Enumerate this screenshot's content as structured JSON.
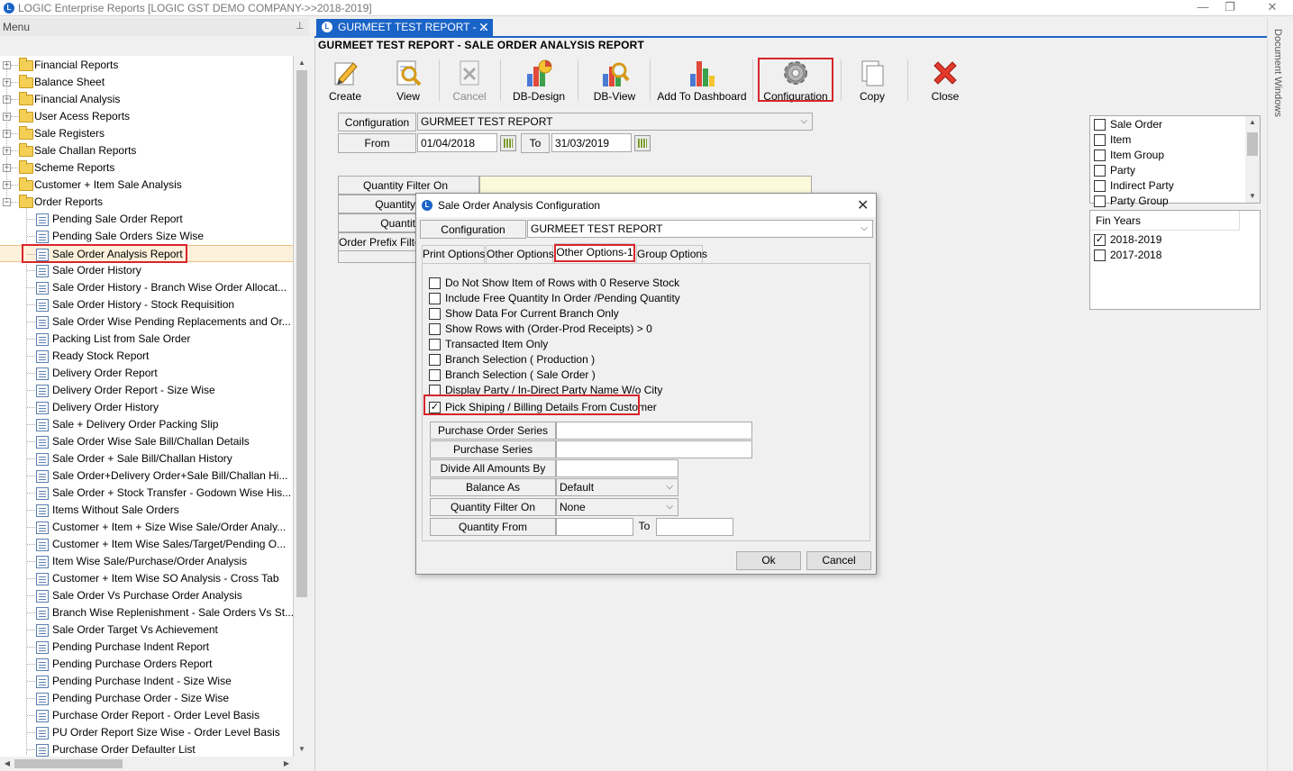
{
  "window": {
    "title": "LOGIC Enterprise Reports  [LOGIC GST DEMO COMPANY->>2018-2019]",
    "minimize": "—",
    "restore": "❐",
    "close": "✕"
  },
  "menu": {
    "header": "Menu",
    "pin": "⊥",
    "folders": [
      {
        "label": "Financial Reports",
        "expanded": false
      },
      {
        "label": "Balance Sheet",
        "expanded": false
      },
      {
        "label": "Financial Analysis",
        "expanded": false
      },
      {
        "label": "User Acess Reports",
        "expanded": false
      },
      {
        "label": "Sale Registers",
        "expanded": false
      },
      {
        "label": "Sale Challan Reports",
        "expanded": false
      },
      {
        "label": "Scheme Reports",
        "expanded": false
      },
      {
        "label": "Customer + Item Sale Analysis",
        "expanded": false
      },
      {
        "label": "Order Reports",
        "expanded": true
      }
    ],
    "order_reports": [
      "Pending Sale Order Report",
      "Pending Sale Orders Size Wise",
      "Sale Order Analysis Report",
      "Sale Order History",
      "Sale Order History - Branch Wise Order Allocat...",
      "Sale Order History - Stock Requisition",
      "Sale Order Wise Pending Replacements and Or...",
      "Packing List from Sale Order",
      "Ready Stock Report",
      "Delivery Order Report",
      "Delivery Order Report - Size Wise",
      "Delivery Order History",
      "Sale + Delivery Order Packing Slip",
      "Sale Order Wise Sale Bill/Challan Details",
      "Sale Order + Sale Bill/Challan History",
      "Sale Order+Delivery Order+Sale Bill/Challan Hi...",
      "Sale Order + Stock Transfer - Godown Wise His...",
      "Items Without Sale Orders",
      "Customer + Item + Size Wise Sale/Order Analy...",
      "Customer + Item Wise Sales/Target/Pending O...",
      "Item Wise Sale/Purchase/Order Analysis",
      "Customer + Item Wise SO Analysis - Cross Tab",
      "Sale Order Vs Purchase Order Analysis",
      "Branch Wise Replenishment - Sale Orders Vs St...",
      "Sale Order Target Vs Achievement",
      "Pending Purchase Indent Report",
      "Pending Purchase Orders Report",
      "Pending Purchase Indent - Size Wise",
      "Pending Purchase Order - Size Wise",
      "Purchase Order Report - Order Level Basis",
      "PU Order Report Size Wise - Order Level Basis",
      "Purchase Order Defaulter List"
    ],
    "selected": "Sale Order Analysis Report",
    "scroll_up": "▲",
    "scroll_down": "▼",
    "scroll_left": "◀",
    "scroll_right": "▶"
  },
  "tab": {
    "title": "GURMEET TEST REPORT - ...",
    "close": "✕"
  },
  "doc_windows_label": "Document Windows",
  "report_header": "GURMEET TEST REPORT - SALE ORDER ANALYSIS REPORT",
  "toolbar": {
    "create": "Create",
    "view": "View",
    "cancel": "Cancel",
    "db_design": "DB-Design",
    "db_view": "DB-View",
    "add_dashboard": "Add To Dashboard",
    "configuration": "Configuration",
    "copy": "Copy",
    "close": "Close"
  },
  "form": {
    "configuration_label": "Configuration",
    "configuration_value": "GURMEET TEST REPORT",
    "from_label": "From",
    "from_value": "01/04/2018",
    "to_label": "To",
    "to_value": "31/03/2019",
    "quantity_filter_label": "Quantity Filter On",
    "quantity_label": "Quantity",
    "quantit_label": "Quantit",
    "order_prefix_label": "Order Prefix Filte"
  },
  "right_panel": {
    "group_items": [
      {
        "label": "Sale Order",
        "checked": false
      },
      {
        "label": "Item",
        "checked": false
      },
      {
        "label": "Item Group",
        "checked": false
      },
      {
        "label": "Party",
        "checked": false
      },
      {
        "label": "Indirect Party",
        "checked": false
      },
      {
        "label": "Party Group",
        "checked": false
      }
    ],
    "fin_years_header": "Fin Years",
    "fin_years": [
      {
        "label": "2018-2019",
        "checked": true
      },
      {
        "label": "2017-2018",
        "checked": false
      }
    ],
    "up": "▲",
    "down": "▼"
  },
  "dialog": {
    "title": "Sale Order Analysis Configuration",
    "close": "✕",
    "configuration_label": "Configuration",
    "configuration_value": "GURMEET TEST REPORT",
    "tabs": [
      "Print Options",
      "Other Options",
      "Other Options-1",
      "Group Options"
    ],
    "active_tab": "Other Options-1",
    "options": [
      {
        "label": "Do Not Show Item of Rows with  0 Reserve Stock",
        "checked": false
      },
      {
        "label": "Include Free Quantity In Order /Pending Quantity",
        "checked": false
      },
      {
        "label": "Show Data For Current Branch Only",
        "checked": false
      },
      {
        "label": "Show Rows with (Order-Prod Receipts) > 0",
        "checked": false
      },
      {
        "label": "Transacted Item Only",
        "checked": false
      },
      {
        "label": "Branch Selection ( Production )",
        "checked": false
      },
      {
        "label": "Branch Selection ( Sale Order )",
        "checked": false
      },
      {
        "label": "Display Party / In-Direct Party Name W/o City",
        "checked": false
      },
      {
        "label": "Pick Shiping / Billing Details From Customer",
        "checked": true
      }
    ],
    "fields": {
      "purchase_order_series": "Purchase Order Series",
      "purchase_series": "Purchase Series",
      "divide_all_amounts_by": "Divide All Amounts By",
      "balance_as": "Balance As",
      "balance_as_value": "Default",
      "quantity_filter_on": "Quantity Filter On",
      "quantity_filter_value": "None",
      "quantity_from": "Quantity From",
      "to": "To"
    },
    "ok": "Ok",
    "cancel": "Cancel",
    "check_mark": "✓",
    "dropdown_arrow": "⌵"
  },
  "colors": {
    "accent": "#1a63c7",
    "highlight_red": "#d8252b",
    "selection": "#fdf1dc"
  }
}
